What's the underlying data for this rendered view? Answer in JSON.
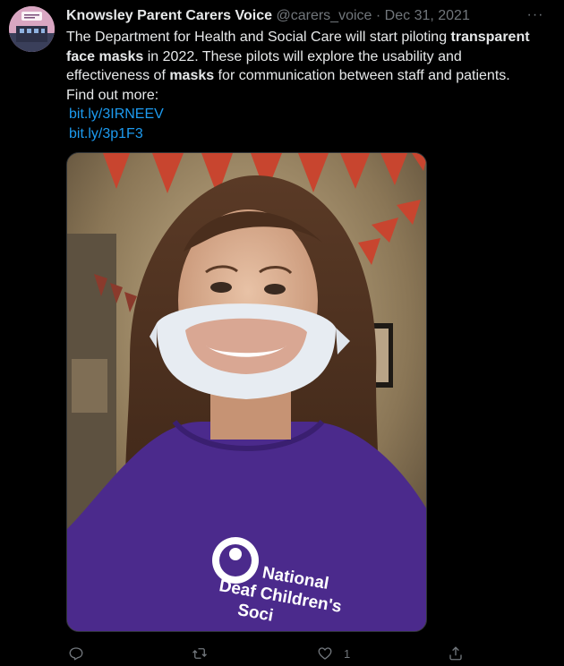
{
  "tweet": {
    "display_name": "Knowsley Parent Carers Voice",
    "handle": "@carers_voice",
    "separator": "·",
    "date": "Dec 31, 2021",
    "more_label": "···",
    "text": {
      "part1": "The Department for Health and Social Care will start piloting ",
      "bold1": "transparent face masks",
      "part2": " in 2022. These pilots will explore the usability and effectiveness of ",
      "bold2": "masks",
      "part3": " for communication between staff and patients.",
      "part4": "Find out more:"
    },
    "links": [
      "bit.ly/3IRNEEV",
      "bit.ly/3p1F3"
    ],
    "photo": {
      "hoodie_text_line1": "National",
      "hoodie_text_line2": "Deaf Children's",
      "hoodie_text_line3": "Soci"
    },
    "actions": {
      "reply_count": "",
      "retweet_count": "",
      "like_count": "1",
      "share_count": ""
    }
  },
  "colors": {
    "background": "#000000",
    "text_primary": "#e7e9ea",
    "text_secondary": "#71767b",
    "link": "#1d9bf0",
    "hoodie_purple": "#4b2a8c",
    "bunting_red": "#c8452f"
  },
  "icons": {
    "more": "more-horizontal-icon",
    "reply": "reply-icon",
    "retweet": "retweet-icon",
    "like": "heart-icon",
    "share": "share-icon"
  }
}
